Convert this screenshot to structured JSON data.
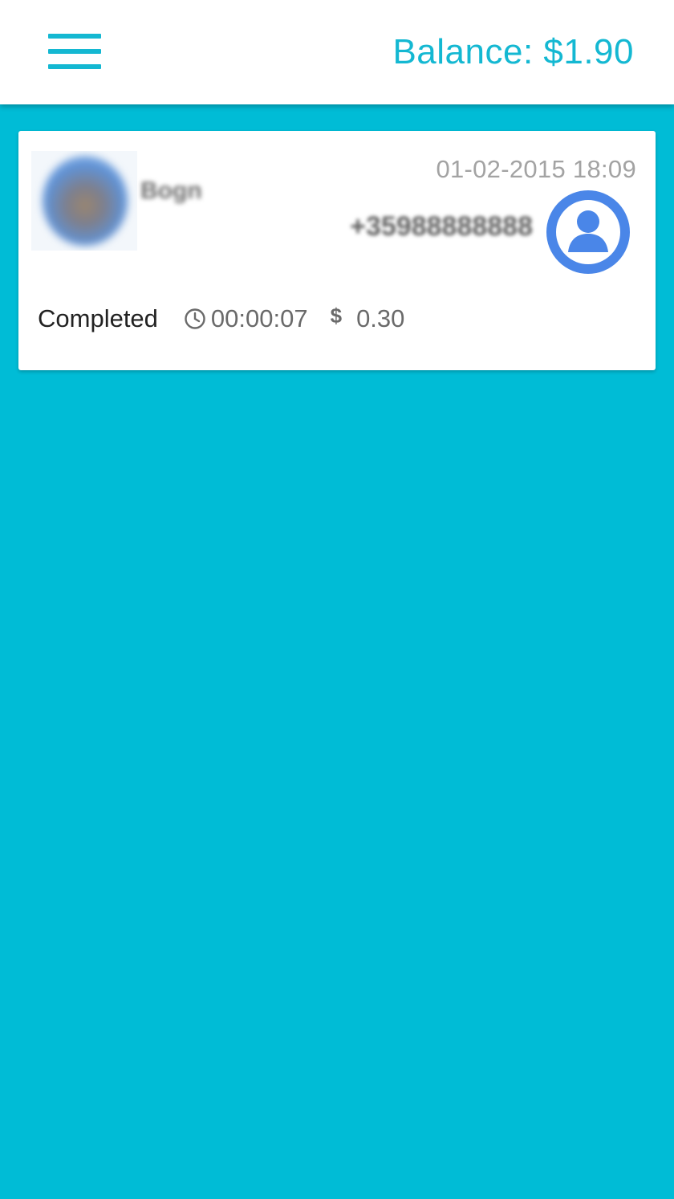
{
  "header": {
    "menu_icon": "hamburger-menu-icon",
    "balance": "Balance: $1.90"
  },
  "call_log": [
    {
      "contact_name": "Bogn",
      "datetime": "01-02-2015 18:09",
      "phone": "+35988888888",
      "status": "Completed",
      "duration": "00:00:07",
      "cost_symbol": "$",
      "cost": "0.30",
      "icons": {
        "avatar": "contact-photo",
        "contact_button": "person-circle-icon",
        "duration": "clock-icon",
        "cost": "dollar-icon"
      }
    }
  ],
  "colors": {
    "accent": "#14B8D2",
    "background": "#00BCD6",
    "contact_icon": "#4A86E8"
  }
}
